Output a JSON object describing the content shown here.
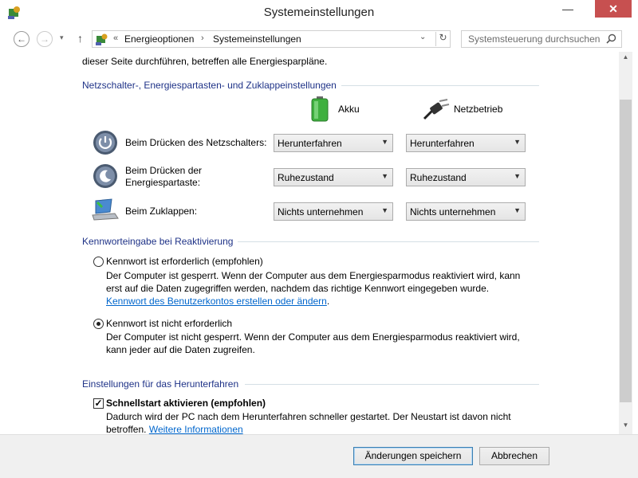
{
  "window": {
    "title": "Systemeinstellungen",
    "minimize": "—",
    "maximize": "□",
    "close": "✕"
  },
  "nav": {
    "back": "←",
    "forward": "→",
    "recent": "▾",
    "up": "↑",
    "breadcrumb_root": "«",
    "breadcrumb": [
      "Energieoptionen",
      "Systemeinstellungen"
    ],
    "breadcrumb_sep": "›",
    "dropdown": "⌄",
    "refresh": "↻",
    "search_placeholder": "Systemsteuerung durchsuchen"
  },
  "intro_text": "dieser Seite durchführen, betreffen alle Energiesparpläne.",
  "buttons_section": {
    "title": "Netzschalter-, Energiespartasten- und Zuklappeinstellungen",
    "col_battery": "Akku",
    "col_plugged": "Netzbetrieb",
    "rows": [
      {
        "label": "Beim Drücken des Netzschalters:",
        "battery": "Herunterfahren",
        "plugged": "Herunterfahren"
      },
      {
        "label_line1": "Beim Drücken der",
        "label_line2": "Energiespartaste:",
        "battery": "Ruhezustand",
        "plugged": "Ruhezustand"
      },
      {
        "label": "Beim Zuklappen:",
        "battery": "Nichts unternehmen",
        "plugged": "Nichts unternehmen"
      }
    ]
  },
  "password_section": {
    "title": "Kennworteingabe bei Reaktivierung",
    "option1": {
      "label": "Kennwort ist erforderlich (empfohlen)",
      "desc1": "Der Computer ist gesperrt. Wenn der Computer aus dem Energiesparmodus reaktiviert wird, kann",
      "desc2": "erst auf die Daten zugegriffen werden, nachdem das richtige Kennwort eingegeben wurde.",
      "link": "Kennwort des Benutzerkontos erstellen oder ändern",
      "link_suffix": "."
    },
    "option2": {
      "label": "Kennwort ist nicht erforderlich",
      "desc1": "Der Computer ist nicht gesperrt. Wenn der Computer aus dem Energiesparmodus reaktiviert wird,",
      "desc2": "kann jeder auf die Daten zugreifen."
    }
  },
  "shutdown_section": {
    "title": "Einstellungen für das Herunterfahren",
    "fast_start": {
      "label": "Schnellstart aktivieren (empfohlen)",
      "checked": true,
      "check_mark": "✓",
      "desc1": "Dadurch wird der PC nach dem Herunterfahren schneller gestartet. Der Neustart ist davon nicht",
      "desc2": "betroffen.",
      "link": "Weitere Informationen"
    }
  },
  "footer": {
    "save": "Änderungen speichern",
    "cancel": "Abbrechen"
  },
  "scroll": {
    "up": "▲",
    "down": "▼"
  },
  "colors": {
    "section_title": "#1e3287",
    "link": "#0066cc",
    "close_button": "#c75050"
  }
}
